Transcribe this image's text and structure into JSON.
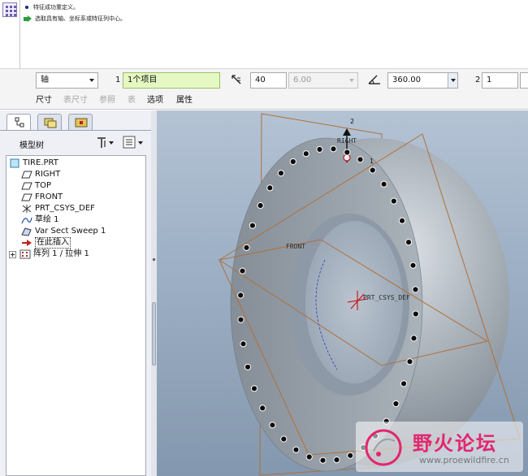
{
  "messages": [
    "特征成功重定义。",
    "选取具有轴、坐标系或特征列中心。"
  ],
  "dashboard": {
    "pattern_type": "轴",
    "first_direction_index": "1",
    "first_reference": "1个项目",
    "member_count": "40",
    "spacing": "6.00",
    "angle_extent": "360.00",
    "second_direction_index": "2",
    "second_direction_count": "1",
    "tabs": [
      {
        "label": "尺寸",
        "enabled": true
      },
      {
        "label": "表尺寸",
        "enabled": false
      },
      {
        "label": "参照",
        "enabled": false
      },
      {
        "label": "表",
        "enabled": false
      },
      {
        "label": "选项",
        "enabled": true
      },
      {
        "label": "属性",
        "enabled": true
      }
    ]
  },
  "navigator": {
    "tree_title": "模型树",
    "items": [
      {
        "label": "TIRE.PRT",
        "icon": "part-icon"
      },
      {
        "label": "RIGHT",
        "icon": "datum-plane-icon"
      },
      {
        "label": "TOP",
        "icon": "datum-plane-icon"
      },
      {
        "label": "FRONT",
        "icon": "datum-plane-icon"
      },
      {
        "label": "PRT_CSYS_DEF",
        "icon": "csys-icon"
      },
      {
        "label": "草绘 1",
        "icon": "sketch-icon"
      },
      {
        "label": "Var Sect Sweep 1",
        "icon": "sweep-icon"
      },
      {
        "label": "在此插入",
        "icon": "insert-arrow-icon"
      },
      {
        "label": "阵列 1 / 拉伸 1",
        "icon": "pattern-icon"
      }
    ]
  },
  "graphics": {
    "datum_labels": {
      "right": "RIGHT",
      "front": "FRONT",
      "csys": "PRT_CSYS_DEF",
      "axis_2": "2",
      "axis_1": "1"
    }
  },
  "watermark": {
    "title": "野火论坛",
    "url": "www.proewildfire.cn"
  },
  "colors": {
    "part_surface": "#9ea6ae",
    "background_top": "#b4c3d4",
    "background_bottom": "#8397ae",
    "datum_plane": "#b0703a",
    "watermark_accent": "#e2266f"
  }
}
